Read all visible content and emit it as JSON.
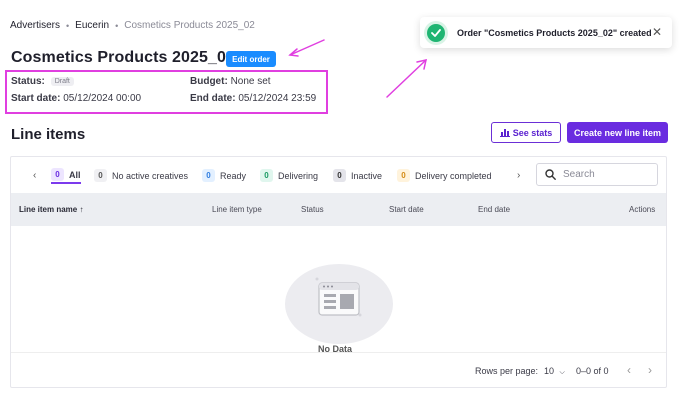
{
  "breadcrumb": [
    "Advertisers",
    "Eucerin",
    "Cosmetics Products 2025_02"
  ],
  "order": {
    "title": "Cosmetics Products 2025_02",
    "edit_label": "Edit order",
    "status_label": "Status:",
    "status_value": "Draft",
    "budget_label": "Budget:",
    "budget_value": "None set",
    "start_label": "Start date:",
    "start_value": "05/12/2024 00:00",
    "end_label": "End date:",
    "end_value": "05/12/2024 23:59"
  },
  "line_items": {
    "title": "Line items",
    "see_stats_label": "See stats",
    "new_label": "Create new line item",
    "filters": [
      {
        "count": "0",
        "label": "All",
        "color": "#ede5ff",
        "text": "#6a2ce0"
      },
      {
        "count": "0",
        "label": "No active creatives",
        "color": "#f0f0f3",
        "text": "#555"
      },
      {
        "count": "0",
        "label": "Ready",
        "color": "#e3f0ff",
        "text": "#2f7de0"
      },
      {
        "count": "0",
        "label": "Delivering",
        "color": "#e0f6ee",
        "text": "#1a9a63"
      },
      {
        "count": "0",
        "label": "Inactive",
        "color": "#e4e4ea",
        "text": "#333"
      },
      {
        "count": "0",
        "label": "Delivery completed",
        "color": "#fff3dc",
        "text": "#d48a12"
      }
    ],
    "search_placeholder": "Search",
    "columns": {
      "name": "Line item name",
      "type": "Line item type",
      "status": "Status",
      "start": "Start date",
      "end": "End date",
      "actions": "Actions"
    },
    "empty_text": "No Data",
    "footer": {
      "rows_label": "Rows per page:",
      "rows_value": "10",
      "range": "0–0 of 0"
    }
  },
  "toast": {
    "message": "Order \"Cosmetics Products 2025_02\" created"
  },
  "colors": {
    "primary": "#6a2ce0",
    "edit_blue": "#1a8cff",
    "annotation": "#e03fe0",
    "success": "#1fb572"
  }
}
